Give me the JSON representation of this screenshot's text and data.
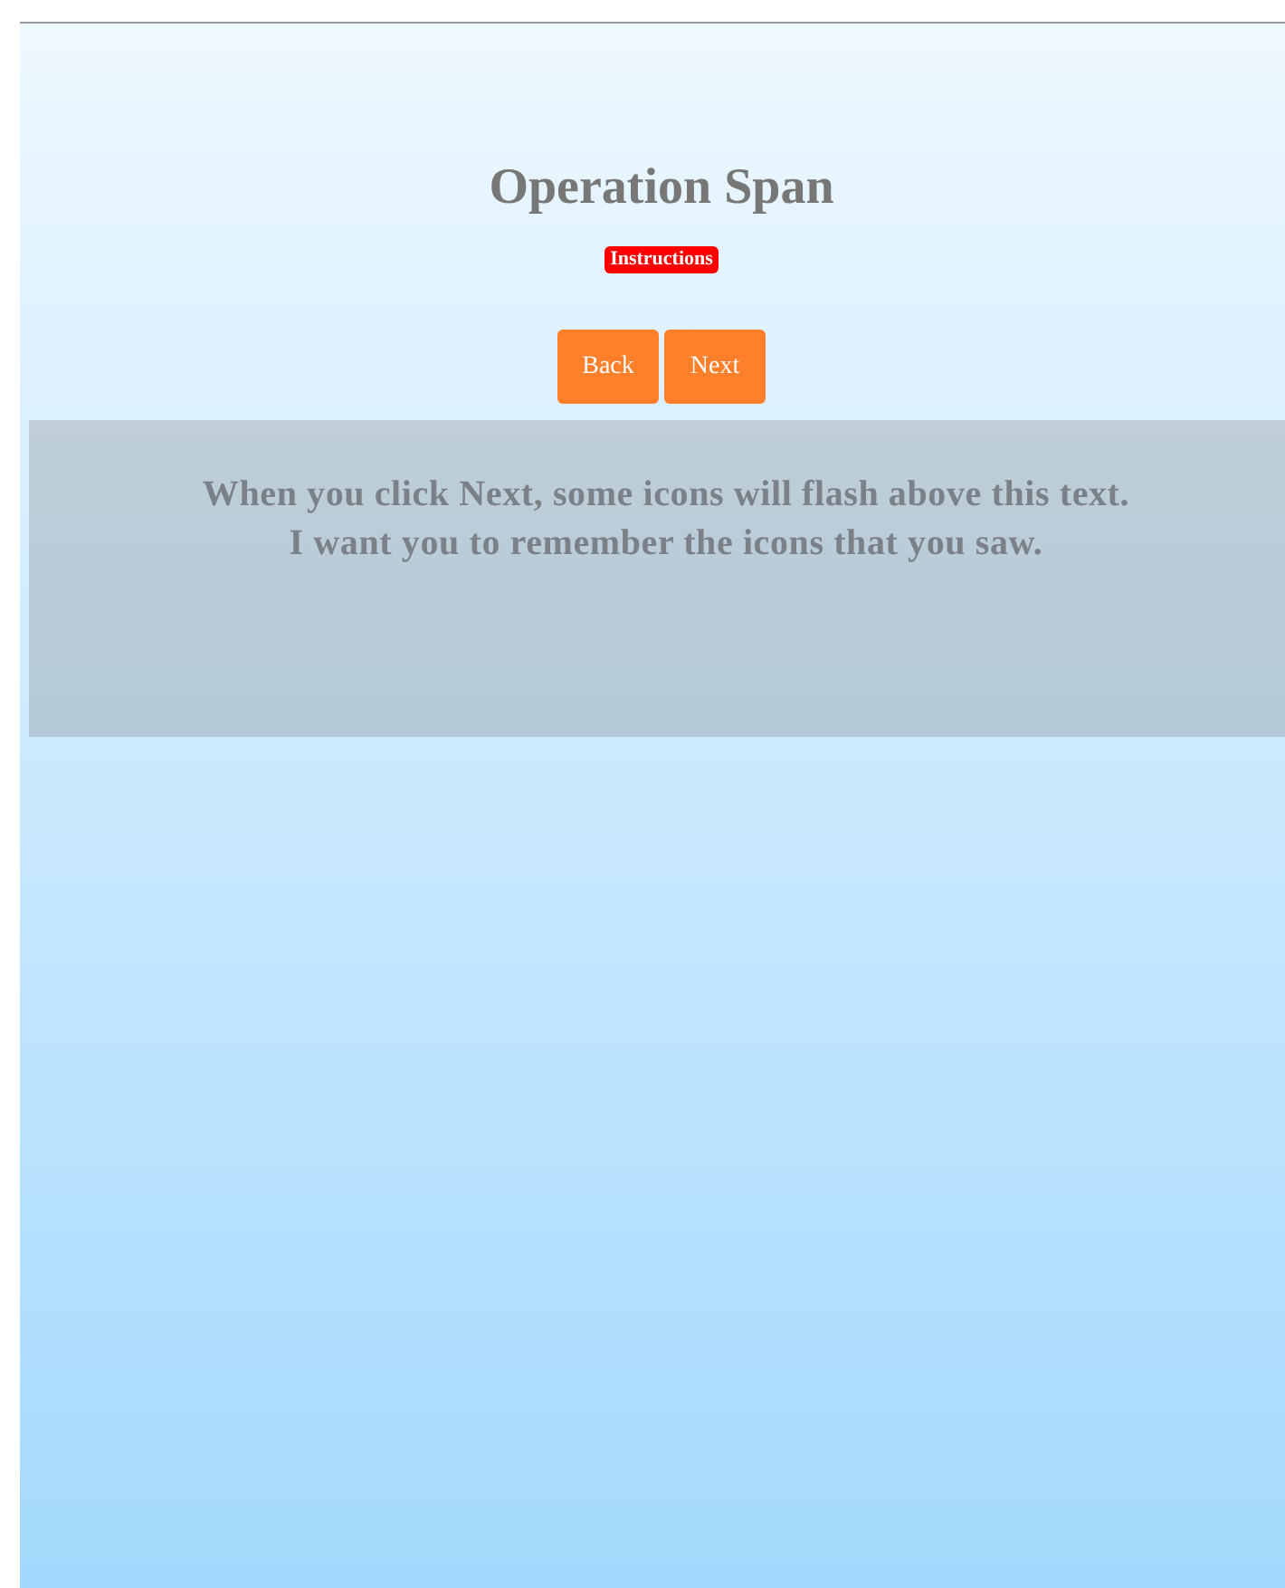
{
  "title": "Operation Span",
  "badge": "Instructions",
  "buttons": [
    {
      "label": "Back"
    },
    {
      "label": "Next"
    }
  ],
  "message_lines": [
    "When you click Next, some icons will flash above this text.",
    "I want you to remember the icons that you saw."
  ]
}
